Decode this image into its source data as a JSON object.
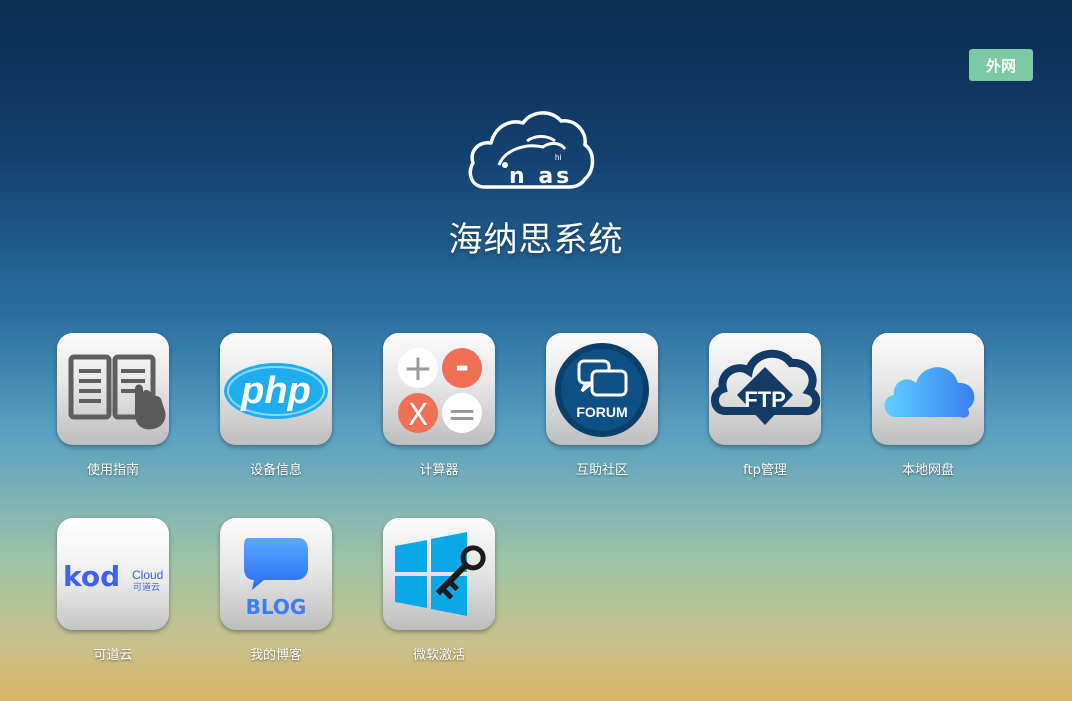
{
  "network_badge": "外网",
  "logo": {
    "small_text": "hi",
    "brand_text": "n as"
  },
  "system_title": "海纳思系统",
  "apps": [
    {
      "label": "使用指南",
      "icon": "book-icon"
    },
    {
      "label": "设备信息",
      "icon": "php-icon"
    },
    {
      "label": "计算器",
      "icon": "calculator-icon",
      "glyphs": [
        "+",
        "-",
        "X",
        "="
      ]
    },
    {
      "label": "互助社区",
      "icon": "forum-icon",
      "text": "FORUM"
    },
    {
      "label": "ftp管理",
      "icon": "ftp-cloud-icon",
      "text": "FTP"
    },
    {
      "label": "本地网盘",
      "icon": "icloud-icon"
    },
    {
      "label": "可道云",
      "icon": "kodcloud-icon",
      "text": "kod",
      "sub1": "Cloud",
      "sub2": "可道云"
    },
    {
      "label": "我的博客",
      "icon": "blog-icon",
      "text": "BLOG"
    },
    {
      "label": "微软激活",
      "icon": "windows-key-icon"
    }
  ]
}
